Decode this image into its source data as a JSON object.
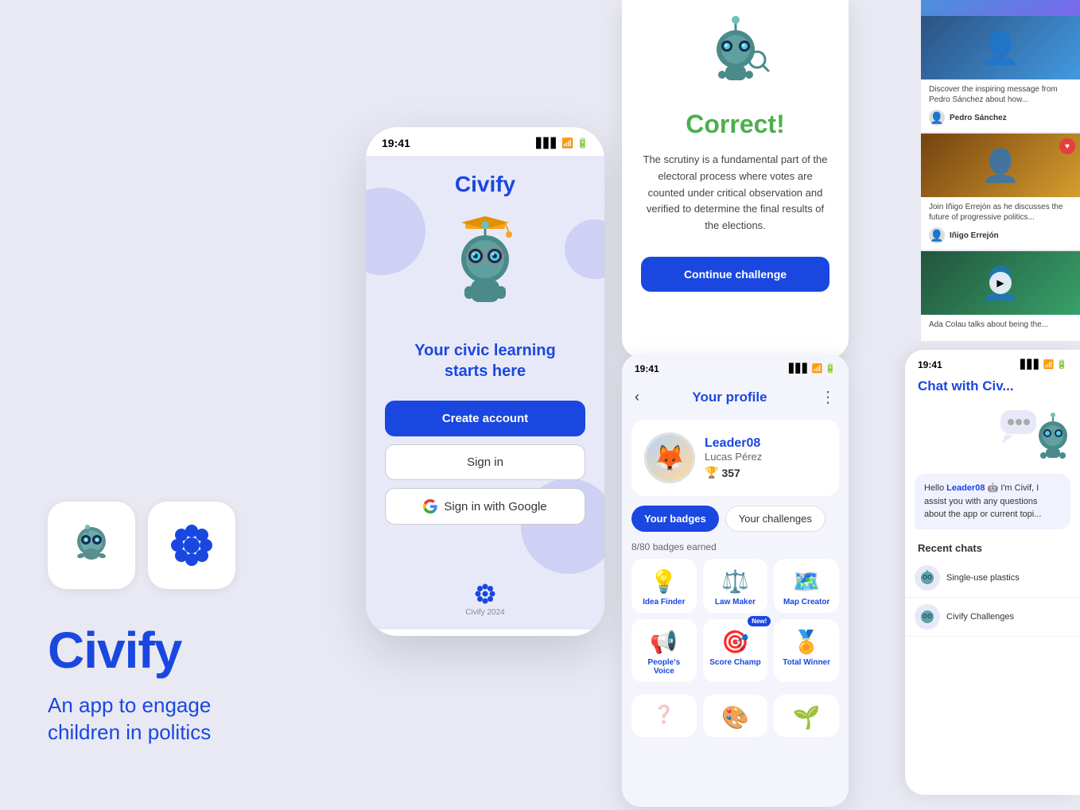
{
  "brand": {
    "name": "Civify",
    "tagline": "An app to engage\nchildren in politics"
  },
  "phone": {
    "status_time": "19:41",
    "logo": "Civify",
    "hero_tagline": "Your civic learning\nstarts here",
    "btn_create": "Create account",
    "btn_signin": "Sign in",
    "btn_google": "Sign in with Google",
    "footer_text": "Civify 2024"
  },
  "correct_screen": {
    "title": "Correct!",
    "description": "The scrutiny is a fundamental part of the electoral process where votes are counted under critical observation and verified to determine the final results of the elections.",
    "btn_continue": "Continue challenge"
  },
  "profile_screen": {
    "status_time": "19:41",
    "title": "Your profile",
    "username": "Leader08",
    "realname": "Lucas Pérez",
    "score": "357",
    "tab_badges": "Your badges",
    "tab_challenges": "Your challenges",
    "badges_count": "8/80 badges earned",
    "badges": [
      {
        "label": "Idea Finder",
        "icon": "💡",
        "new": false
      },
      {
        "label": "Law Maker",
        "icon": "⚖️",
        "new": false
      },
      {
        "label": "Map Creator",
        "icon": "🗺️",
        "new": false
      },
      {
        "label": "People's Voice",
        "icon": "📢",
        "new": false
      },
      {
        "label": "Score Champ",
        "icon": "🎯",
        "new": true
      },
      {
        "label": "Total Winner",
        "icon": "🏆",
        "new": false
      }
    ]
  },
  "videos": [
    {
      "desc": "Discover the inspiring message from Pedro Sánchez about how...",
      "author": "Pedro Sánchez",
      "has_heart": false,
      "has_play": false
    },
    {
      "desc": "Join Iñigo Errejón as he discusses the future of progressive politics...",
      "author": "Iñigo Errejón",
      "has_heart": true,
      "has_play": false
    },
    {
      "desc": "Ada Colau talks about being the...",
      "author": "Ada Colau",
      "has_heart": true,
      "has_play": true
    }
  ],
  "chat": {
    "status_time": "19:41",
    "title": "Chat with Civ",
    "bubble": "Hello Leader08 🤖 I'm Civif, I assist you with any questions about the app or current topi...",
    "recent_title": "Recent chats",
    "recent_items": [
      "Single-use plastics",
      "Civify Challenges"
    ]
  }
}
